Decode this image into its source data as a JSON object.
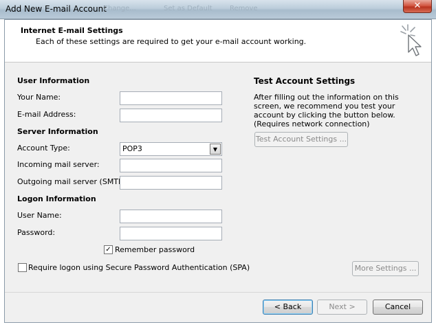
{
  "window": {
    "title": "Add New E-mail Account",
    "ghost_tabs": [
      "Change...",
      "Set as Default",
      "Remove"
    ],
    "close_glyph": "✕"
  },
  "header": {
    "title": "Internet E-mail Settings",
    "subtitle": "Each of these settings are required to get your e-mail account working.",
    "icon": "wizard-cursor-icon"
  },
  "user_info": {
    "title": "User Information",
    "your_name_label": "Your Name:",
    "your_name_value": "",
    "email_label": "E-mail Address:",
    "email_value": ""
  },
  "server_info": {
    "title": "Server Information",
    "account_type_label": "Account Type:",
    "account_type_value": "POP3",
    "incoming_label": "Incoming mail server:",
    "incoming_value": "",
    "outgoing_label": "Outgoing mail server (SMTP):",
    "outgoing_value": ""
  },
  "logon_info": {
    "title": "Logon Information",
    "username_label": "User Name:",
    "username_value": "",
    "password_label": "Password:",
    "password_value": "",
    "remember_label": "Remember password",
    "remember_checked": true,
    "spa_label": "Require logon using Secure Password Authentication (SPA)",
    "spa_checked": false
  },
  "test_settings": {
    "title": "Test Account Settings",
    "description": "After filling out the information on this screen, we recommend you test your account by clicking the button below. (Requires network connection)",
    "button_label": "Test Account Settings ..."
  },
  "buttons": {
    "more_settings": "More Settings ...",
    "back": "< Back",
    "next": "Next >",
    "cancel": "Cancel"
  }
}
